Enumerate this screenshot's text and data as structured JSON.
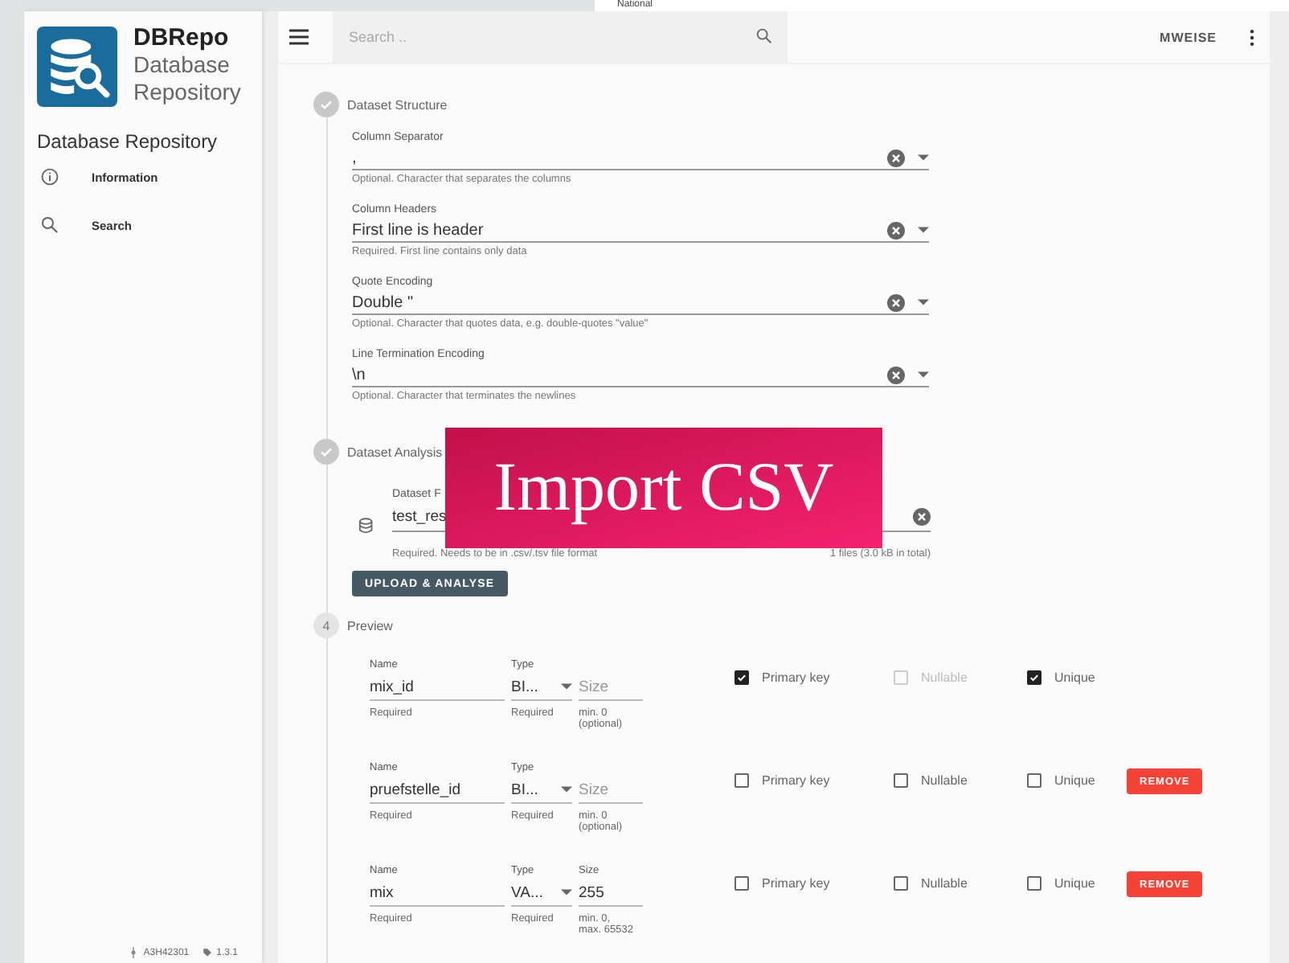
{
  "background_window": {
    "text": "National"
  },
  "sidebar": {
    "logo": {
      "title": "DBRepo",
      "subtitle": "Database Repository"
    },
    "heading": "Database Repository",
    "items": [
      {
        "label": "Information"
      },
      {
        "label": "Search"
      }
    ],
    "footer": {
      "commit": "A3H42301",
      "version": "1.3.1"
    }
  },
  "topbar": {
    "search_placeholder": "Search ..",
    "user": "MWEISE"
  },
  "steps": [
    {
      "title": "Dataset Structure",
      "completed": true,
      "fields": [
        {
          "label": "Column Separator",
          "value": ",",
          "hint": "Optional. Character that separates the columns"
        },
        {
          "label": "Column Headers",
          "value": "First line is header",
          "hint": "Required. First line contains only data"
        },
        {
          "label": "Quote Encoding",
          "value": "Double \"",
          "hint": "Optional. Character that quotes data, e.g. double-quotes \"value\""
        },
        {
          "label": "Line Termination Encoding",
          "value": "\\n",
          "hint": "Optional. Character that terminates the newlines"
        }
      ]
    },
    {
      "title": "Dataset Analysis",
      "completed": true,
      "file": {
        "label": "Dataset F",
        "value": "test_res",
        "hint": "Required. Needs to be in .csv/.tsv file format",
        "count": "1 files (3.0 kB in total)"
      },
      "button": "UPLOAD & ANALYSE"
    },
    {
      "title": "Preview",
      "completed": false,
      "number": "4",
      "columns": [
        {
          "name_label": "Name",
          "name": "mix_id",
          "name_hint": "Required",
          "type_label": "Type",
          "type": "BI...",
          "type_hint": "Required",
          "size_placeholder": "Size",
          "size_hint": "min. 0\n(optional)",
          "checks": [
            {
              "label": "Primary key",
              "checked": true,
              "disabled": false
            },
            {
              "label": "Nullable",
              "checked": false,
              "disabled": true
            },
            {
              "label": "Unique",
              "checked": true,
              "disabled": false
            }
          ]
        },
        {
          "name_label": "Name",
          "name": "pruefstelle_id",
          "name_hint": "Required",
          "type_label": "Type",
          "type": "BI...",
          "type_hint": "Required",
          "size_placeholder": "Size",
          "size_hint": "min. 0\n(optional)",
          "checks": [
            {
              "label": "Primary key",
              "checked": false,
              "disabled": false
            },
            {
              "label": "Nullable",
              "checked": false,
              "disabled": false
            },
            {
              "label": "Unique",
              "checked": false,
              "disabled": false
            }
          ],
          "remove_button": "REMOVE"
        },
        {
          "name_label": "Name",
          "name": "mix",
          "name_hint": "Required",
          "type_label": "Type",
          "type": "VA...",
          "type_hint": "Required",
          "size_label": "Size",
          "size": "255",
          "size_hint": "min. 0,\nmax. 65532",
          "checks": [
            {
              "label": "Primary key",
              "checked": false,
              "disabled": false
            },
            {
              "label": "Nullable",
              "checked": false,
              "disabled": false
            },
            {
              "label": "Unique",
              "checked": false,
              "disabled": false
            }
          ],
          "remove_button": "REMOVE"
        }
      ]
    }
  ],
  "overlay": {
    "title": "Import CSV"
  }
}
